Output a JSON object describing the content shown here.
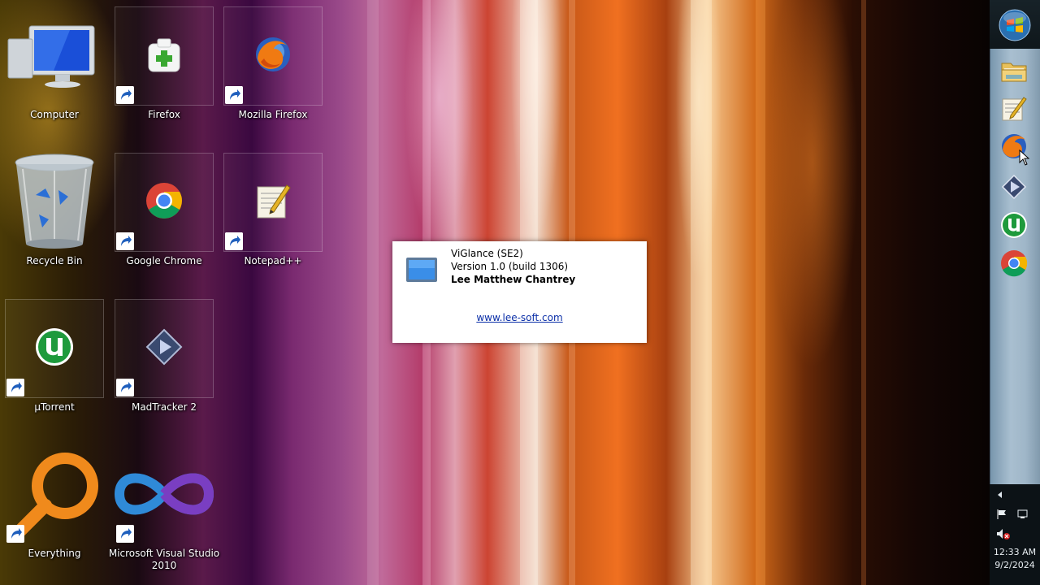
{
  "desktop": {
    "icons": [
      {
        "label": "Computer"
      },
      {
        "label": "Firefox"
      },
      {
        "label": "Mozilla Firefox"
      },
      {
        "label": "Recycle Bin"
      },
      {
        "label": "Google Chrome"
      },
      {
        "label": "Notepad++"
      },
      {
        "label": "µTorrent"
      },
      {
        "label": "MadTracker 2"
      },
      {
        "label": "Everything"
      },
      {
        "label": "Microsoft Visual Studio 2010"
      }
    ]
  },
  "about_dialog": {
    "app_name": "ViGlance (SE2)",
    "version": "Version 1.0 (build 1306)",
    "author": "Lee Matthew Chantrey",
    "website": "www.lee-soft.com"
  },
  "taskbar": {
    "start_icon": "windows-orb-icon",
    "pinned": [
      "folder-icon",
      "notepad-icon",
      "firefox-icon",
      "madtracker-icon",
      "utorrent-icon",
      "chrome-icon"
    ]
  },
  "tray": {
    "time": "12:33 AM",
    "date": "9/2/2024"
  },
  "colors": {
    "dialog_link": "#0b2fa8",
    "taskbar_glass": "#a9bfd0"
  }
}
